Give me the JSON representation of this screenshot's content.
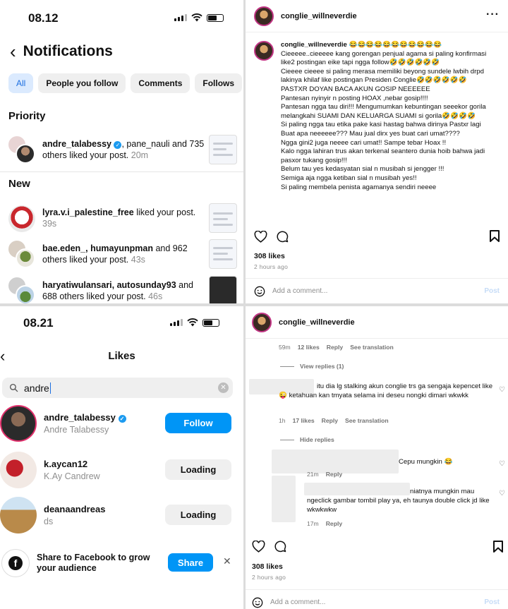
{
  "notifications": {
    "status_time": "08.12",
    "title": "Notifications",
    "chips": [
      "All",
      "People you follow",
      "Comments",
      "Follows"
    ],
    "priority_label": "Priority",
    "new_label": "New",
    "priority_item": {
      "users": "andre_talabessy",
      "rest": ", pane_nauli and 735 others liked your post.",
      "time": "20m"
    },
    "new_items": [
      {
        "users": "lyra.v.i_palestine_free",
        "rest": " liked your post.",
        "time": "39s"
      },
      {
        "users": "bae.eden_, humayunpman",
        "rest": " and 962 others liked your post.",
        "time": "43s"
      },
      {
        "users": "haryatiwulansari, autosunday93",
        "rest": " and 688 others liked your post.",
        "time": "46s"
      }
    ]
  },
  "post1": {
    "username": "conglie_willneverdie",
    "caption_user": "conglie_willneverdie",
    "caption_text": " 😂😂😂😂😂😂😂😂😂😂😂\nCieeeee..cieeeee kang gorengan penjual agama si paling konfirmasi like2 postingan eike tapi ngga follow🤣🤣🤣🤣🤣🤣\nCieeee cieeee si paling merasa memiliki beyong sundele lwbih drpd lakinya khilaf like postingan Presiden Conglie🤣🤣🤣🤣🤣🤣\nPASTXR DOYAN BACA AKUN GOSIP NEEEEEE\nPantesan nyinyir n posting HOAX ,nebar gosip!!!!\nPantesan ngga tau diri!!! Mengumumkan kebuntingan seeekor gorila melangkahi SUAMI DAN KELUARGA SUAMI si gorila🤣🤣🤣🤣\nSi paling ngga tau etika pake kasi hastag bahwa dirinya Pastxr lagi\nBuat apa neeeeee??? Mau jual dirx yes buat cari umat????\nNgga gini2 juga neeee cari umat!! Sampe tebar Hoax !!\nKalo ngga lahiran trus akan terkenal seantero dunia hoib bahwa jadi pasxor tukang gosip!!!\nBelum tau yes kedasyatan sial n musibah si jengger !!!\nSemiga aja ngga ketiban sial n musibah yes!!\nSi paling membela penista agamanya sendiri neeee",
    "likes": "308 likes",
    "ago": "2 hours ago",
    "add_comment": "Add a comment...",
    "post_label": "Post"
  },
  "likes_screen": {
    "status_time": "08.21",
    "title": "Likes",
    "search_value": "andre",
    "rows": [
      {
        "username": "andre_talabessy",
        "fullname": "Andre Talabessy",
        "button": "Follow",
        "verified": true
      },
      {
        "username": "k.aycan12",
        "fullname": "K.Ay Candrew",
        "button": "Loading",
        "verified": false
      },
      {
        "username": "deanaandreas",
        "fullname": "ds",
        "button": "Loading",
        "verified": false
      }
    ],
    "share_text": "Share to Facebook to grow your audience",
    "share_button": "Share"
  },
  "post2": {
    "username": "conglie_willneverdie",
    "top_meta": {
      "time": "59m",
      "likes": "12 likes",
      "reply": "Reply",
      "translate": "See translation"
    },
    "view_replies": "View replies (1)",
    "comment1": {
      "text": "itu dia lg stalking akun conglie trs ga sengaja kepencet like😜 ketahuan kan tmyata selama ini deseu nongki dimari wkwkk",
      "time": "1h",
      "likes": "17 likes",
      "reply": "Reply",
      "translate": "See translation"
    },
    "hide_replies": "Hide replies",
    "reply1": {
      "text": "Cepu mungkin 😂",
      "time": "21m",
      "reply": "Reply"
    },
    "reply2": {
      "text": "niatnya mungkin mau ngeclick gambar tombil play ya, eh taunya double click jd like wkwkwkw",
      "time": "17m",
      "reply": "Reply"
    },
    "likes": "308 likes",
    "ago": "2 hours ago",
    "add_comment": "Add a comment...",
    "post_label": "Post"
  },
  "colors": {
    "accent": "#0095f6",
    "chip_active_bg": "#dbeafe",
    "verified": "#1d9bf0"
  }
}
